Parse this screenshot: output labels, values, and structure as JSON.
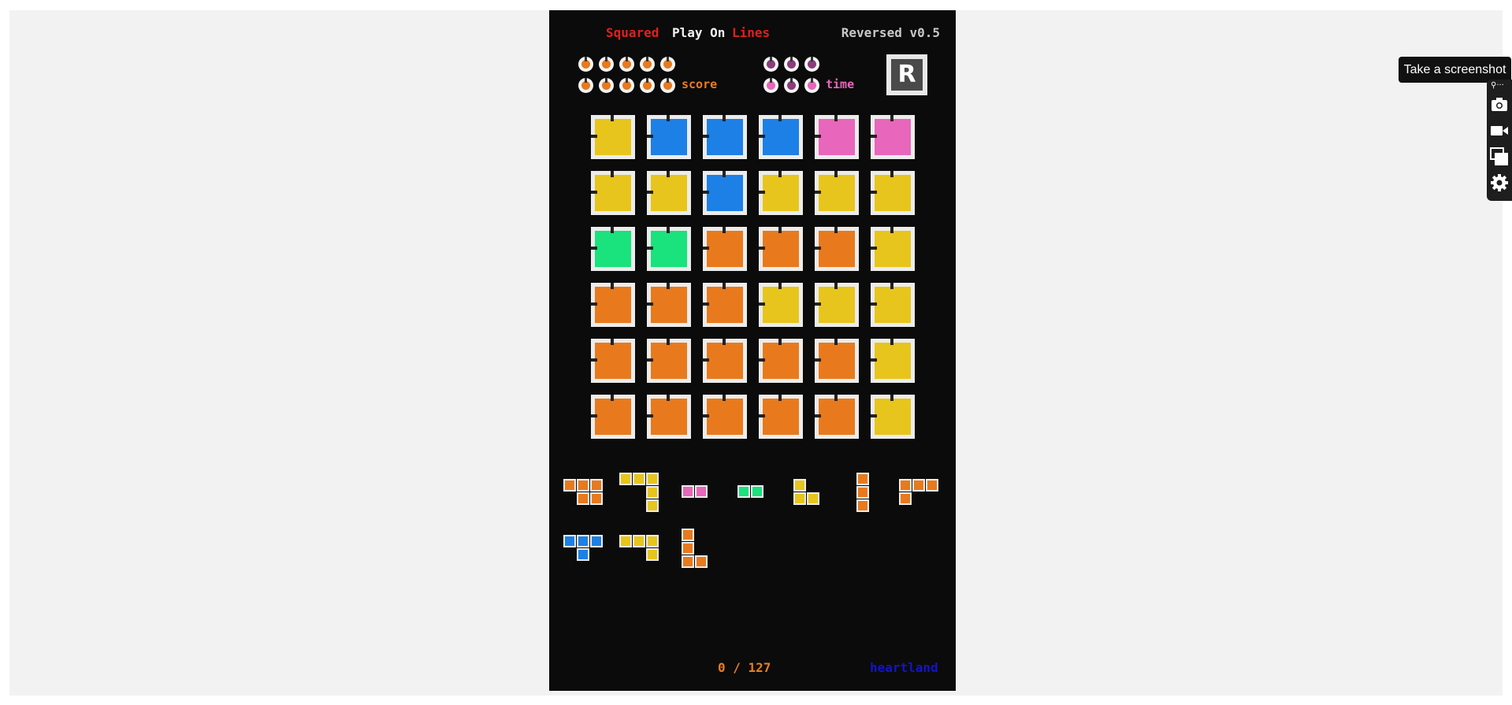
{
  "game": {
    "title_parts": [
      "Squared",
      "Play",
      "On",
      "Lines"
    ],
    "version": "Reversed v0.5",
    "score_label": "score",
    "time_label": "time",
    "logo_letter": "R",
    "progress": "0 / 127",
    "credit_link": "heartland"
  },
  "colors": {
    "yellow": "#e8c51c",
    "blue": "#1d80e6",
    "pink": "#e866bb",
    "green": "#1ae27c",
    "orange": "#e87a1d",
    "score_dial": "#e8791c",
    "time_dial_dark": "#8b3c7a",
    "time_dial_light": "#e866bb"
  },
  "board": [
    [
      "yellow",
      "blue",
      "blue",
      "blue",
      "pink",
      "pink"
    ],
    [
      "yellow",
      "yellow",
      "blue",
      "yellow",
      "yellow",
      "yellow"
    ],
    [
      "green",
      "green",
      "orange",
      "orange",
      "orange",
      "yellow"
    ],
    [
      "orange",
      "orange",
      "orange",
      "yellow",
      "yellow",
      "yellow"
    ],
    [
      "orange",
      "orange",
      "orange",
      "orange",
      "orange",
      "yellow"
    ],
    [
      "orange",
      "orange",
      "orange",
      "orange",
      "orange",
      "yellow"
    ]
  ],
  "pieces": [
    {
      "name": "piece-1",
      "color": "orange",
      "cells": [
        [
          0,
          0
        ],
        [
          1,
          0
        ],
        [
          2,
          0
        ],
        [
          1,
          1
        ],
        [
          2,
          1
        ]
      ]
    },
    {
      "name": "piece-2",
      "color": "yellow",
      "cells": [
        [
          0,
          0
        ],
        [
          1,
          0
        ],
        [
          2,
          0
        ],
        [
          2,
          1
        ],
        [
          2,
          2
        ]
      ]
    },
    {
      "name": "piece-3",
      "color": "pink",
      "cells": [
        [
          0,
          0
        ],
        [
          1,
          0
        ]
      ]
    },
    {
      "name": "piece-4",
      "color": "green",
      "cells": [
        [
          0,
          0
        ],
        [
          1,
          0
        ]
      ]
    },
    {
      "name": "piece-5",
      "color": "yellow",
      "cells": [
        [
          0,
          0
        ],
        [
          0,
          1
        ],
        [
          1,
          1
        ]
      ]
    },
    {
      "name": "piece-6",
      "color": "orange",
      "cells": [
        [
          0,
          0
        ],
        [
          0,
          1
        ],
        [
          0,
          2
        ]
      ]
    },
    {
      "name": "piece-7",
      "color": "orange",
      "cells": [
        [
          0,
          0
        ],
        [
          1,
          0
        ],
        [
          2,
          0
        ],
        [
          0,
          1
        ]
      ]
    },
    {
      "name": "piece-8",
      "color": "blue",
      "cells": [
        [
          0,
          0
        ],
        [
          1,
          0
        ],
        [
          2,
          0
        ],
        [
          1,
          1
        ]
      ]
    },
    {
      "name": "piece-9",
      "color": "yellow",
      "cells": [
        [
          0,
          0
        ],
        [
          1,
          0
        ],
        [
          2,
          0
        ],
        [
          2,
          1
        ]
      ]
    },
    {
      "name": "piece-10",
      "color": "orange",
      "cells": [
        [
          0,
          0
        ],
        [
          0,
          1
        ],
        [
          0,
          2
        ],
        [
          1,
          2
        ]
      ]
    }
  ],
  "toolbar": {
    "tooltip": "Take a screenshot",
    "buttons": [
      "camera-icon",
      "video-icon",
      "windows-icon",
      "gear-icon"
    ]
  }
}
